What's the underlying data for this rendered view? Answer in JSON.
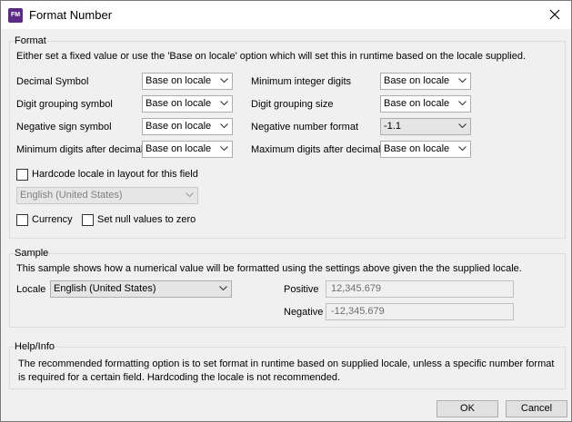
{
  "window": {
    "title": "Format Number",
    "close_icon": "close-icon",
    "app_icon_text": "FM"
  },
  "format": {
    "title": "Format",
    "description": "Either set a fixed value or use the 'Base on locale' option which will set this in runtime based on the locale supplied.",
    "decimal_symbol": {
      "label": "Decimal Symbol",
      "value": "Base on locale"
    },
    "digit_grouping_symbol": {
      "label": "Digit grouping symbol",
      "value": "Base on locale"
    },
    "negative_sign_symbol": {
      "label": "Negative sign symbol",
      "value": "Base on locale"
    },
    "min_digits_after_decimal": {
      "label": "Minimum digits after decimal",
      "value": "Base on locale"
    },
    "min_integer_digits": {
      "label": "Minimum integer digits",
      "value": "Base on locale"
    },
    "digit_grouping_size": {
      "label": "Digit grouping size",
      "value": "Base on locale"
    },
    "negative_number_format": {
      "label": "Negative number format",
      "value": "-1.1"
    },
    "max_digits_after_decimal": {
      "label": "Maximum digits after decimal",
      "value": "Base on locale"
    },
    "hardcode_locale": {
      "label": "Hardcode locale in layout for this field",
      "checked": false
    },
    "hardcode_locale_value": "English (United States)",
    "currency": {
      "label": "Currency",
      "checked": false
    },
    "null_to_zero": {
      "label": "Set null values to zero",
      "checked": false
    }
  },
  "sample": {
    "title": "Sample",
    "description": "This sample shows how a numerical value will be formatted using the settings above given the the supplied locale.",
    "locale_label": "Locale",
    "locale_value": "English (United States)",
    "positive_label": "Positive",
    "positive_value": "12,345.679",
    "negative_label": "Negative",
    "negative_value": "-12,345.679"
  },
  "help": {
    "title": "Help/Info",
    "text": "The recommended formatting option is to set format in runtime based on supplied locale, unless a specific number format is required for a certain field. Hardcoding the locale is not recommended."
  },
  "buttons": {
    "ok": "OK",
    "cancel": "Cancel"
  },
  "colors": {
    "app_icon": "#5b2a86",
    "dialog_bg": "#f0f0f0",
    "border": "#dcdcdc"
  }
}
